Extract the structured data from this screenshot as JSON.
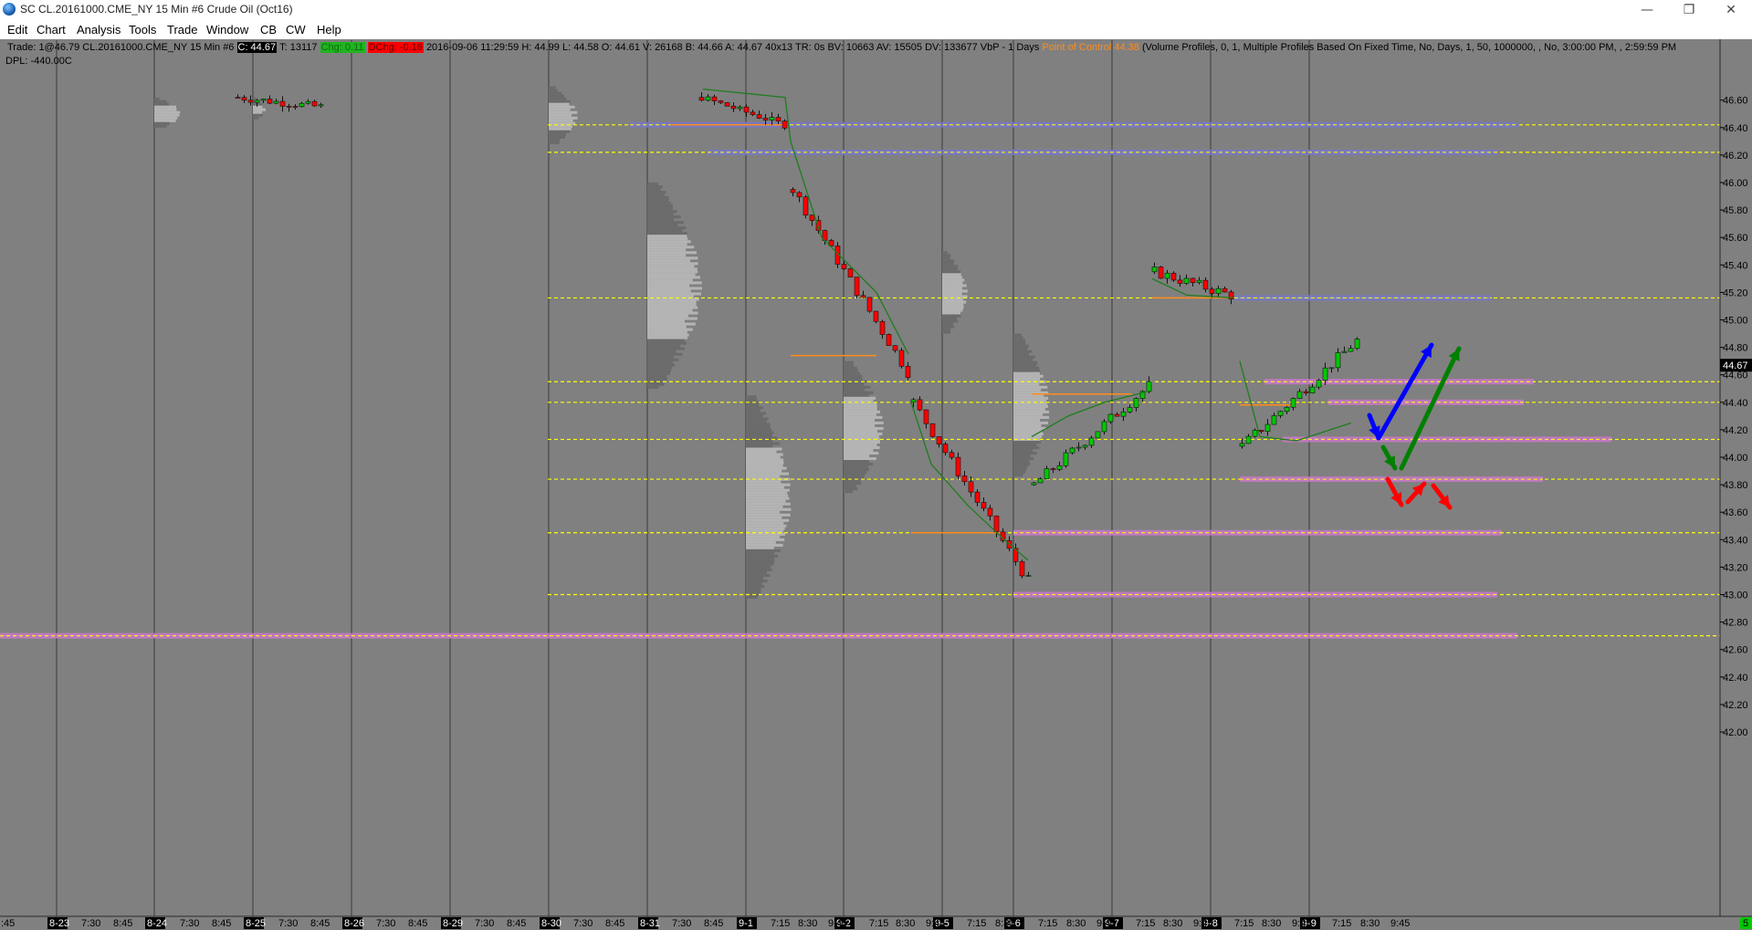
{
  "window": {
    "title": "SC CL.20161000.CME_NY  15 Min  #6  Crude Oil (Oct16)",
    "minimize_symbol": "—",
    "restore_symbol": "❐",
    "close_symbol": "✕"
  },
  "menu": {
    "items": [
      "Edit",
      "Chart",
      "Analysis",
      "Tools",
      "Trade",
      "Window",
      "CB",
      "CW",
      "Help"
    ]
  },
  "info": {
    "prefix": "Trade: 1@46.79  CL.20161000.CME_NY  15 Min  #6",
    "close_badge": "C: 44.67",
    "ticks": "T: 13117",
    "chg_badge": "Chg: 0.11",
    "dchg_badge": "DChg: -0.16",
    "ohlc": "2016-09-06 11:29:59  H: 44.99  L: 44.58  O: 44.61  V: 26168  B: 44.66  A: 44.67  40x13  TR: 0s  BV: 10663  AV: 15505  DV: 133677  VbP - 1 Days",
    "poc_text": "Point of Control 44.38",
    "study_text": "(Volume Profiles, 0, 1, Multiple Profiles Based On Fixed Time, No, Days, 1, 50, 1000000, , No, 3:00:00 PM, , 2:59:59 PM",
    "dpl": "DPL: -440.00C"
  },
  "colors": {
    "background": "#808080",
    "profile_dark": "#6b6b6b",
    "profile_light": "#b4b4b4",
    "candle_up": "#00c800",
    "candle_down": "#ff0000",
    "poc": "#ff8c1a",
    "vwap": "#1e7d1e",
    "level_yellow": "#ffff00",
    "band_blue": "#7878c8",
    "band_pink": "#c878c8",
    "arrow_blue": "#0000ff",
    "arrow_green": "#008000",
    "arrow_red": "#ff0000"
  },
  "price_axis": {
    "ticks": [
      "46.60",
      "46.40",
      "46.20",
      "46.00",
      "45.80",
      "45.60",
      "45.40",
      "45.20",
      "45.00",
      "44.80",
      "44.60",
      "44.40",
      "44.20",
      "44.00",
      "43.80",
      "43.60",
      "43.40",
      "43.20",
      "43.00",
      "42.80",
      "42.60",
      "42.40",
      "42.20",
      "42.00"
    ],
    "current_price": "44.67",
    "range": [
      41.9,
      46.7
    ]
  },
  "time_axis": {
    "date_labels": [
      "8-23",
      "8-24",
      "8-25",
      "8-26",
      "8-29",
      "8-30",
      "8-31",
      "9-1",
      "9-2",
      "9-5",
      "9-6",
      "9-7",
      "9-8",
      "9-9"
    ],
    "time_labels": [
      "7:30",
      "8:45",
      "7:30",
      "8:45",
      "7:30",
      "8:45",
      "7:30",
      "8:45",
      "7:30",
      "8:45",
      "7:30",
      "8:45",
      "7:30",
      "8:45",
      "7:15",
      "8:30",
      "9:45",
      "7:15",
      "8:30",
      "9:45",
      "7:15",
      "8:30",
      "7:15",
      "8:30",
      "9:45",
      "7:15",
      "8:30",
      "9:45",
      "7:15",
      "8:30",
      "9:45",
      "7:15",
      "8:30",
      "9:45"
    ],
    "left_fragment": ":45",
    "right_fragment": "5"
  },
  "levels": [
    46.42,
    46.22,
    45.16,
    44.55,
    44.4,
    44.13,
    43.84,
    43.45,
    43.0,
    42.7
  ],
  "session_pocs": [
    46.42,
    44.74,
    43.45,
    44.46,
    45.16,
    44.38
  ],
  "candles_sample_ohlc": [
    {
      "session": "8-30",
      "o": 46.6,
      "h": 46.7,
      "l": 46.3,
      "c": 46.42
    },
    {
      "session": "8-31",
      "o": 45.95,
      "h": 46.02,
      "l": 44.58,
      "c": 44.65
    },
    {
      "session": "9-1",
      "o": 44.4,
      "h": 44.45,
      "l": 43.02,
      "c": 43.1
    },
    {
      "session": "9-2",
      "o": 43.8,
      "h": 44.65,
      "l": 43.75,
      "c": 44.5
    },
    {
      "session": "9-5",
      "o": 45.3,
      "h": 45.45,
      "l": 44.9,
      "c": 45.16
    },
    {
      "session": "9-6",
      "o": 44.1,
      "h": 44.99,
      "l": 43.85,
      "c": 44.67
    }
  ]
}
